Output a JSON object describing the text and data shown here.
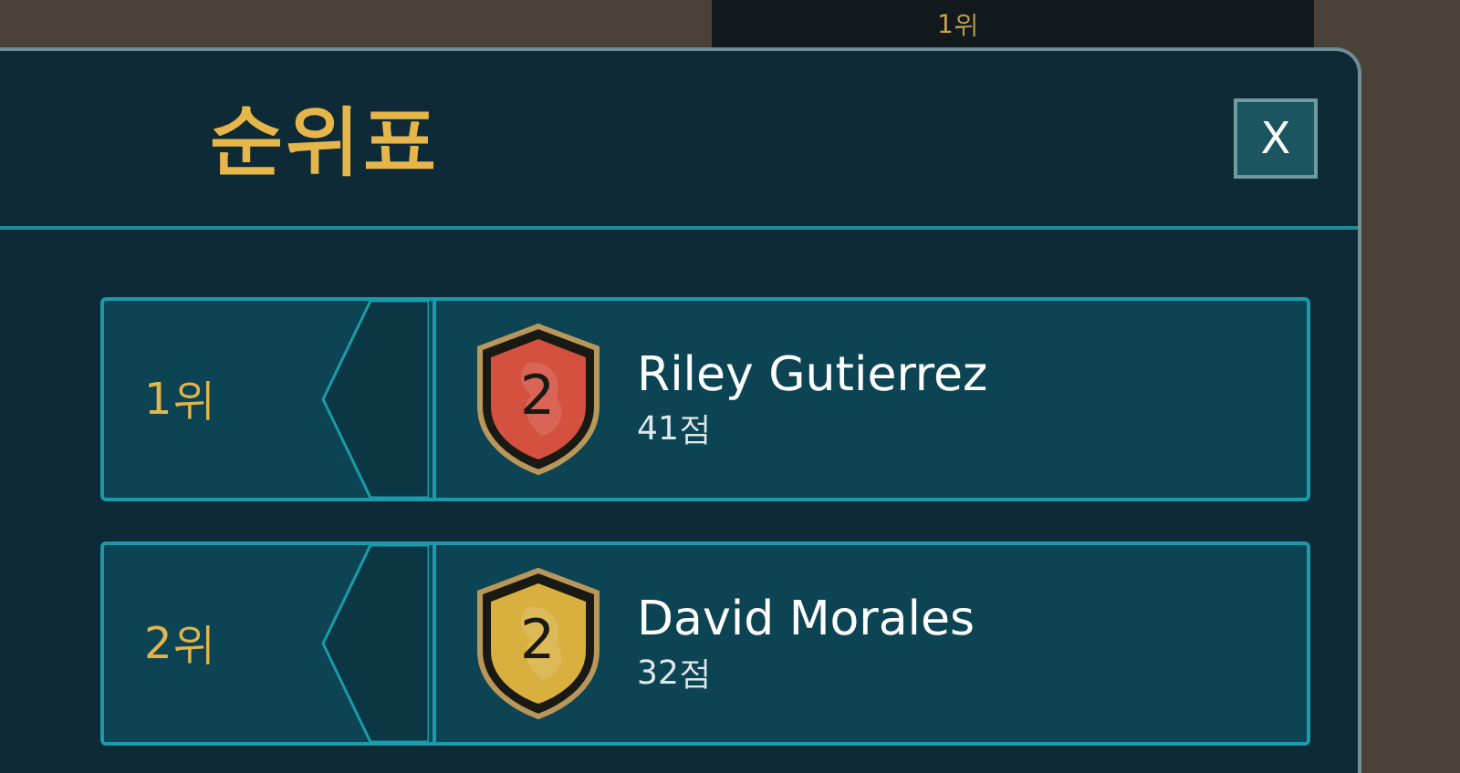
{
  "background_label": "1위",
  "dialog": {
    "title": "순위표",
    "close_label": "X"
  },
  "rankings": [
    {
      "rank": "1위",
      "badge": "2",
      "color": "#d4503f",
      "name": "Riley Gutierrez",
      "score": "41점"
    },
    {
      "rank": "2위",
      "badge": "2",
      "color": "#d9b040",
      "name": "David Morales",
      "score": "32점"
    }
  ]
}
